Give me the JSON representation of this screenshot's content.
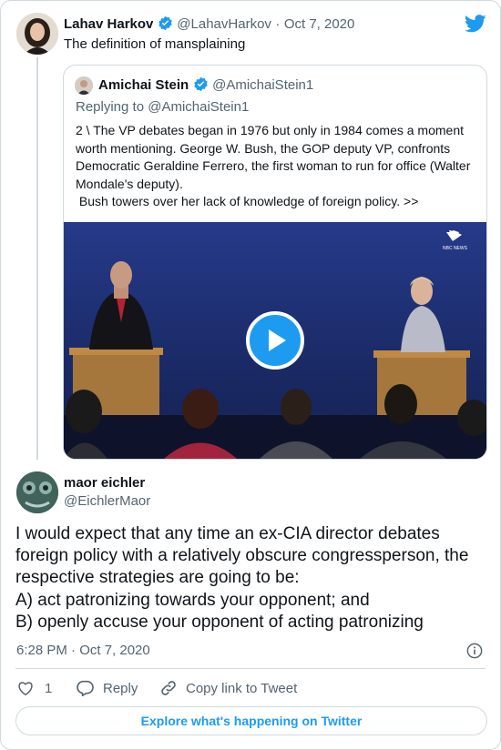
{
  "tweet": {
    "author_name": "Lahav Harkov",
    "author_handle": "@LahavHarkov",
    "sep": "·",
    "date": "Oct 7, 2020",
    "text": "The definition of mansplaining"
  },
  "quoted": {
    "author_name": "Amichai Stein",
    "author_handle": "@AmichaiStein1",
    "replying_prefix": "Replying to ",
    "replying_handle": "@AmichaiStein1",
    "text": "2 \\ The VP debates began in 1976 but only in 1984 comes a moment worth mentioning. George W. Bush, the GOP deputy VP, confronts Democratic Geraldine Ferrero, the first woman to run for office (Walter Mondale's deputy).\n Bush towers over her lack of knowledge of foreign policy. >>",
    "video_watermark": "NBC NEWS"
  },
  "reply": {
    "author_name": "maor eichler",
    "author_handle": "@EichlerMaor",
    "text": "I would expect that any time an ex-CIA director debates foreign policy with a relatively obscure congressperson, the respective strategies are going to be:\nA) act patronizing towards your opponent; and\nB) openly accuse your opponent of acting patronizing",
    "timestamp": "6:28 PM · Oct 7, 2020"
  },
  "actions": {
    "like_count": "1",
    "reply_label": "Reply",
    "copy_link_label": "Copy link to Tweet"
  },
  "explore_label": "Explore what's happening on Twitter",
  "colors": {
    "accent": "#1d9bf0",
    "muted": "#536471",
    "border": "#cfd9de"
  },
  "icons": [
    "twitter-logo-icon",
    "verified-badge-icon",
    "play-icon",
    "info-icon",
    "heart-icon",
    "reply-icon",
    "link-icon"
  ]
}
